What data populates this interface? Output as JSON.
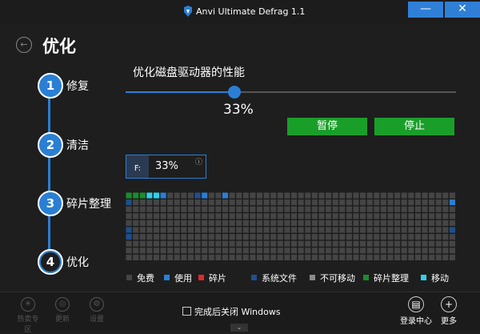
{
  "window": {
    "title": "Anvi Ultimate Defrag 1.1",
    "minimize_symbol": "—",
    "close_symbol": "✕",
    "back_symbol": "←"
  },
  "page": {
    "title": "优化"
  },
  "steps": [
    {
      "number": "1",
      "label": "修复",
      "state": "done"
    },
    {
      "number": "2",
      "label": "清洁",
      "state": "done"
    },
    {
      "number": "3",
      "label": "碎片整理",
      "state": "done"
    },
    {
      "number": "4",
      "label": "优化",
      "state": "current"
    }
  ],
  "performance": {
    "label": "优化磁盘驱动器的性能",
    "slider_fraction": 0.33,
    "value_text": "33%"
  },
  "buttons": {
    "pause": "暂停",
    "stop": "停止"
  },
  "drive": {
    "letter": "F:",
    "percent": "33%",
    "info_symbol": "ⓘ"
  },
  "disk_map": {
    "rows": 10,
    "cols": 48,
    "states": {
      "0,0": "defragmented",
      "0,1": "defragmented",
      "0,2": "defragmented",
      "0,3": "moving",
      "0,4": "moving",
      "0,5": "used",
      "0,10": "system",
      "0,11": "used",
      "0,14": "used",
      "1,0": "system",
      "1,47": "used",
      "5,0": "system",
      "5,47": "system",
      "6,0": "system"
    },
    "colors": {
      "free": "#454545",
      "used": "#2a7fd4",
      "fragmented": "#e0282e",
      "system": "#1f4f8f",
      "unmovable": "#8a8a8a",
      "defragmented": "#1a8c2e",
      "moving": "#2fd0e8"
    }
  },
  "legend": [
    {
      "key": "free",
      "label": "免费"
    },
    {
      "key": "used",
      "label": "使用"
    },
    {
      "key": "fragmented",
      "label": "碎片"
    },
    {
      "key": "system",
      "label": "系统文件"
    },
    {
      "key": "unmovable",
      "label": "不可移动"
    },
    {
      "key": "defragmented",
      "label": "碎片整理"
    },
    {
      "key": "moving",
      "label": "移动"
    }
  ],
  "footer": {
    "left_items": [
      {
        "label": "热卖专区",
        "icon": "sun-icon"
      },
      {
        "label": "更新",
        "icon": "update-icon"
      },
      {
        "label": "设置",
        "icon": "settings-icon"
      }
    ],
    "shutdown_label": "完成后关闭 Windows",
    "shutdown_checked": false,
    "login_label": "登录中心",
    "more_label": "更多",
    "expand_symbol": "⌄"
  }
}
